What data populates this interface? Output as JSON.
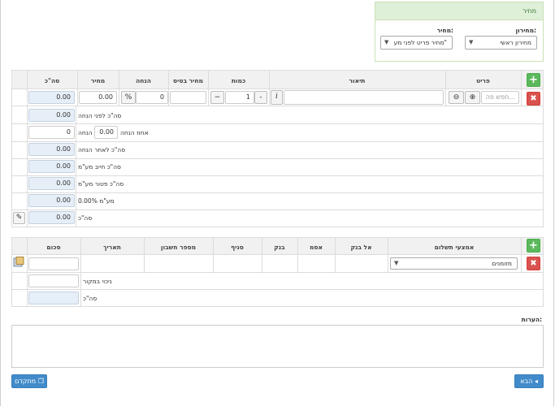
{
  "price_panel": {
    "title": "מחיר",
    "pricelist_label": "מחירון:",
    "pricelist_value": "מחירון ראשי",
    "price_label": "מחיר:",
    "price_value": "מחיר פריט לפני מע\""
  },
  "items": {
    "headers": {
      "item": "פריט",
      "description": "תיאור",
      "quantity": "כמות",
      "base_price": "מחיר בסיס",
      "discount": "הנחה",
      "price": "מחיר",
      "total": "סה\"כ"
    },
    "row": {
      "search_placeholder": "חפש פה...",
      "info_label": "i",
      "quantity": "1",
      "minus": "-",
      "plus": "+",
      "discount_value": "0",
      "discount_unit": "%",
      "price": "0.00",
      "total": "0.00"
    },
    "summary": [
      {
        "label": "סה\"כ לפני הנחה",
        "value": "0.00"
      },
      {
        "label": "אחוז הנחה",
        "value": "0.00",
        "label2": "הנחה",
        "value2": "0"
      },
      {
        "label": "סה\"כ לאחר הנחה",
        "value": "0.00"
      },
      {
        "label": "סה\"כ חייב מע\"מ",
        "value": "0.00"
      },
      {
        "label": "סה\"כ פטור מע\"מ",
        "value": "0.00"
      },
      {
        "label": "מע\"מ 0.00%",
        "value": "0.00"
      },
      {
        "label": "סה\"כ",
        "value": "0.00"
      }
    ]
  },
  "payments": {
    "headers": {
      "method": "אמצעי תשלום",
      "bank_name": "אל בנק",
      "receipt": "אסמ",
      "bank": "בנק",
      "branch": "סניף",
      "account": "מספר חשבון",
      "date": "תאריך",
      "amount": "סכום"
    },
    "row": {
      "method_value": "מזומנים"
    },
    "withholding_label": "ניכוי במקור",
    "total_label": "סה\"כ"
  },
  "notes_label": "הערות:",
  "footer": {
    "next_button": "הבא",
    "advanced_button": "מתקדם"
  }
}
